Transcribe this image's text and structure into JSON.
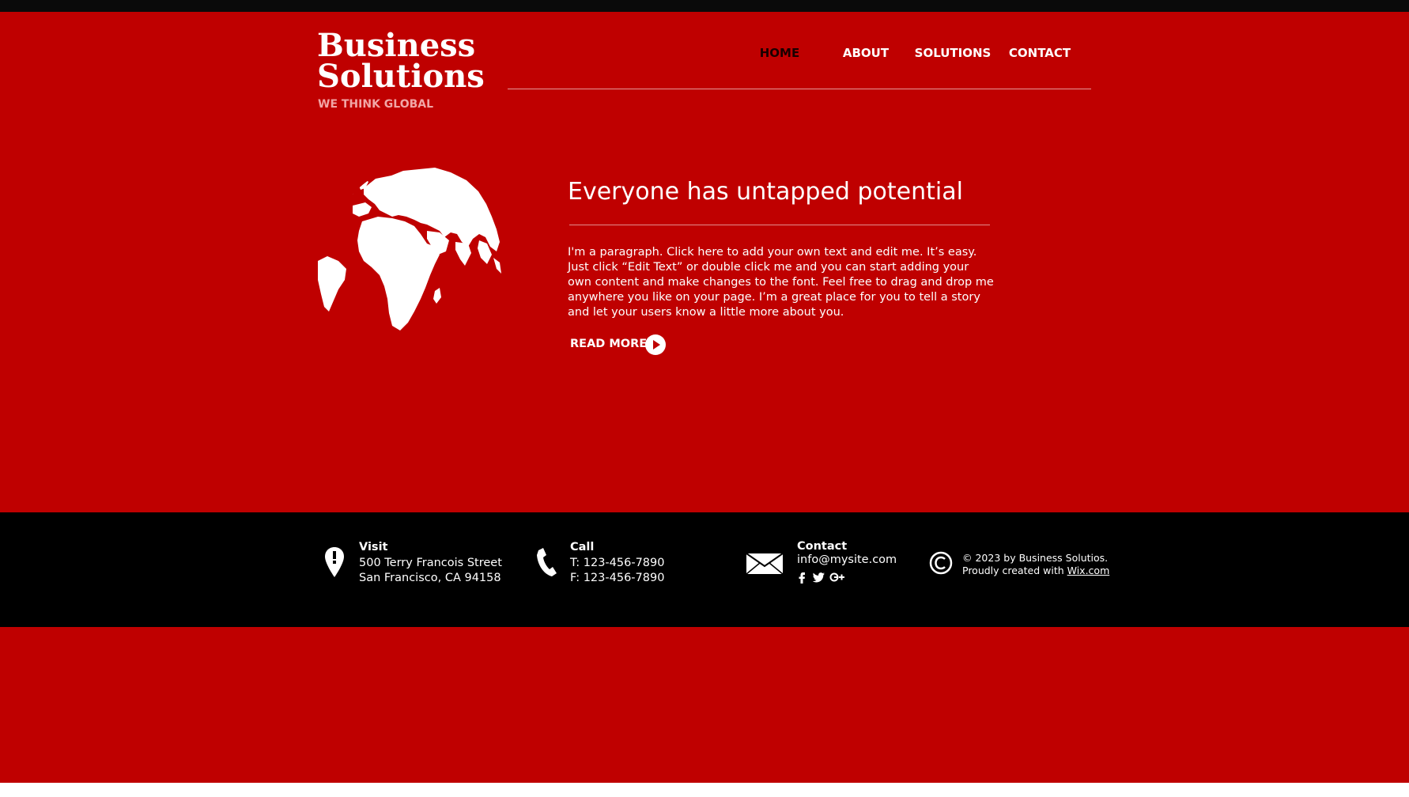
{
  "brand": {
    "title_line1": "Business",
    "title_line2": "Solutions",
    "tagline": "WE THINK GLOBAL"
  },
  "nav": {
    "items": [
      {
        "label": "HOME",
        "active": true
      },
      {
        "label": "ABOUT",
        "active": false
      },
      {
        "label": "SOLUTIONS",
        "active": false
      },
      {
        "label": "CONTACT",
        "active": false
      }
    ]
  },
  "hero": {
    "icon": "globe-icon",
    "headline": "Everyone has untapped potential",
    "paragraph": "I'm a paragraph. Click here to add your own text and edit me. It’s easy. Just click “Edit Text” or double click me and you can start adding your own content and make changes to the font. Feel free to drag and drop me anywhere you like on your page. I’m a great place for you to tell a story and let your users know a little more about you.",
    "read_more": "READ MORE"
  },
  "footer": {
    "visit": {
      "title": "Visit",
      "line1": "500 Terry Francois Street",
      "line2": "San Francisco, CA 94158",
      "icon": "map-pin-icon"
    },
    "call": {
      "title": "Call",
      "line1": "T: 123-456-7890",
      "line2": "F: 123-456-7890",
      "icon": "phone-icon"
    },
    "contact": {
      "title": "Contact",
      "email": "info@mysite.com",
      "icon": "envelope-icon",
      "social": [
        "facebook-icon",
        "twitter-icon",
        "google-plus-icon"
      ]
    },
    "copyright": {
      "line1": "© 2023 by Business Solutios.",
      "line2_prefix": "Proudly created with ",
      "link": "Wix.com",
      "icon": "copyright-icon"
    }
  },
  "colors": {
    "primary_red": "#bf0000",
    "footer_black": "#000000",
    "text_white": "#ffffff",
    "tagline_pink": "#f1a6a6",
    "active_nav": "#1a0000"
  }
}
